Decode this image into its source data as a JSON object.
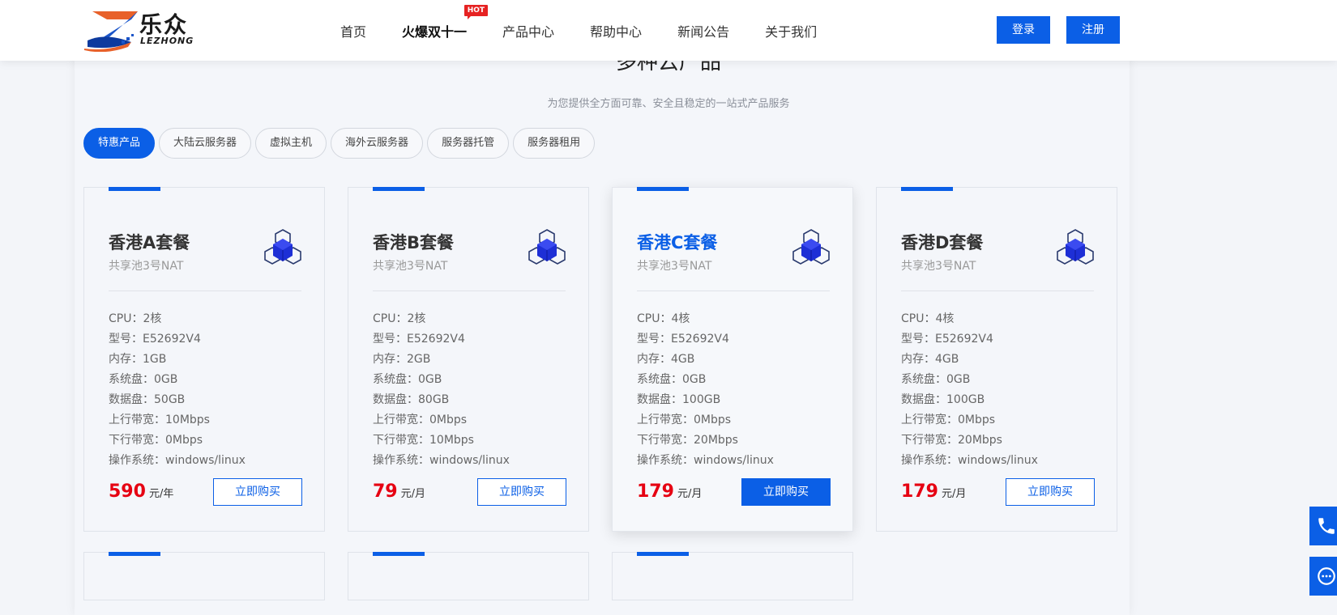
{
  "header": {
    "logo_cn": "乐众",
    "logo_en": "LEZHONG",
    "nav": [
      {
        "label": "首页"
      },
      {
        "label": "火爆双十一",
        "badge": "HOT"
      },
      {
        "label": "产品中心"
      },
      {
        "label": "帮助中心"
      },
      {
        "label": "新闻公告"
      },
      {
        "label": "关于我们"
      }
    ],
    "login_label": "登录",
    "register_label": "注册"
  },
  "section": {
    "title": "多种云产品",
    "subtitle": "为您提供全方面可靠、安全且稳定的一站式产品服务"
  },
  "tabs": [
    {
      "label": "特惠产品",
      "active": true
    },
    {
      "label": "大陆云服务器"
    },
    {
      "label": "虚拟主机"
    },
    {
      "label": "海外云服务器"
    },
    {
      "label": "服务器托管"
    },
    {
      "label": "服务器租用"
    }
  ],
  "cards": [
    {
      "name": "香港A套餐",
      "pool": "共享池3号NAT",
      "specs": [
        "CPU：2核",
        "型号：E52692V4",
        "内存：1GB",
        "系统盘：0GB",
        "数据盘：50GB",
        "上行带宽：10Mbps",
        "下行带宽：0Mbps",
        "操作系统：windows/linux"
      ],
      "price": "590",
      "unit": "元/年",
      "buy_label": "立即购买"
    },
    {
      "name": "香港B套餐",
      "pool": "共享池3号NAT",
      "specs": [
        "CPU：2核",
        "型号：E52692V4",
        "内存：2GB",
        "系统盘：0GB",
        "数据盘：80GB",
        "上行带宽：0Mbps",
        "下行带宽：10Mbps",
        "操作系统：windows/linux"
      ],
      "price": "79",
      "unit": "元/月",
      "buy_label": "立即购买"
    },
    {
      "name": "香港C套餐",
      "pool": "共享池3号NAT",
      "specs": [
        "CPU：4核",
        "型号：E52692V4",
        "内存：4GB",
        "系统盘：0GB",
        "数据盘：100GB",
        "上行带宽：0Mbps",
        "下行带宽：20Mbps",
        "操作系统：windows/linux"
      ],
      "price": "179",
      "unit": "元/月",
      "buy_label": "立即购买"
    },
    {
      "name": "香港D套餐",
      "pool": "共享池3号NAT",
      "specs": [
        "CPU：4核",
        "型号：E52692V4",
        "内存：4GB",
        "系统盘：0GB",
        "数据盘：100GB",
        "上行带宽：0Mbps",
        "下行带宽：20Mbps",
        "操作系统：windows/linux"
      ],
      "price": "179",
      "unit": "元/月",
      "buy_label": "立即购买"
    }
  ],
  "colors": {
    "accent": "#0b5fe6",
    "price": "#e60012",
    "hot": "#e62222"
  },
  "icons": [
    "logo-z-icon",
    "cube-icon",
    "phone-icon",
    "chat-icon"
  ]
}
